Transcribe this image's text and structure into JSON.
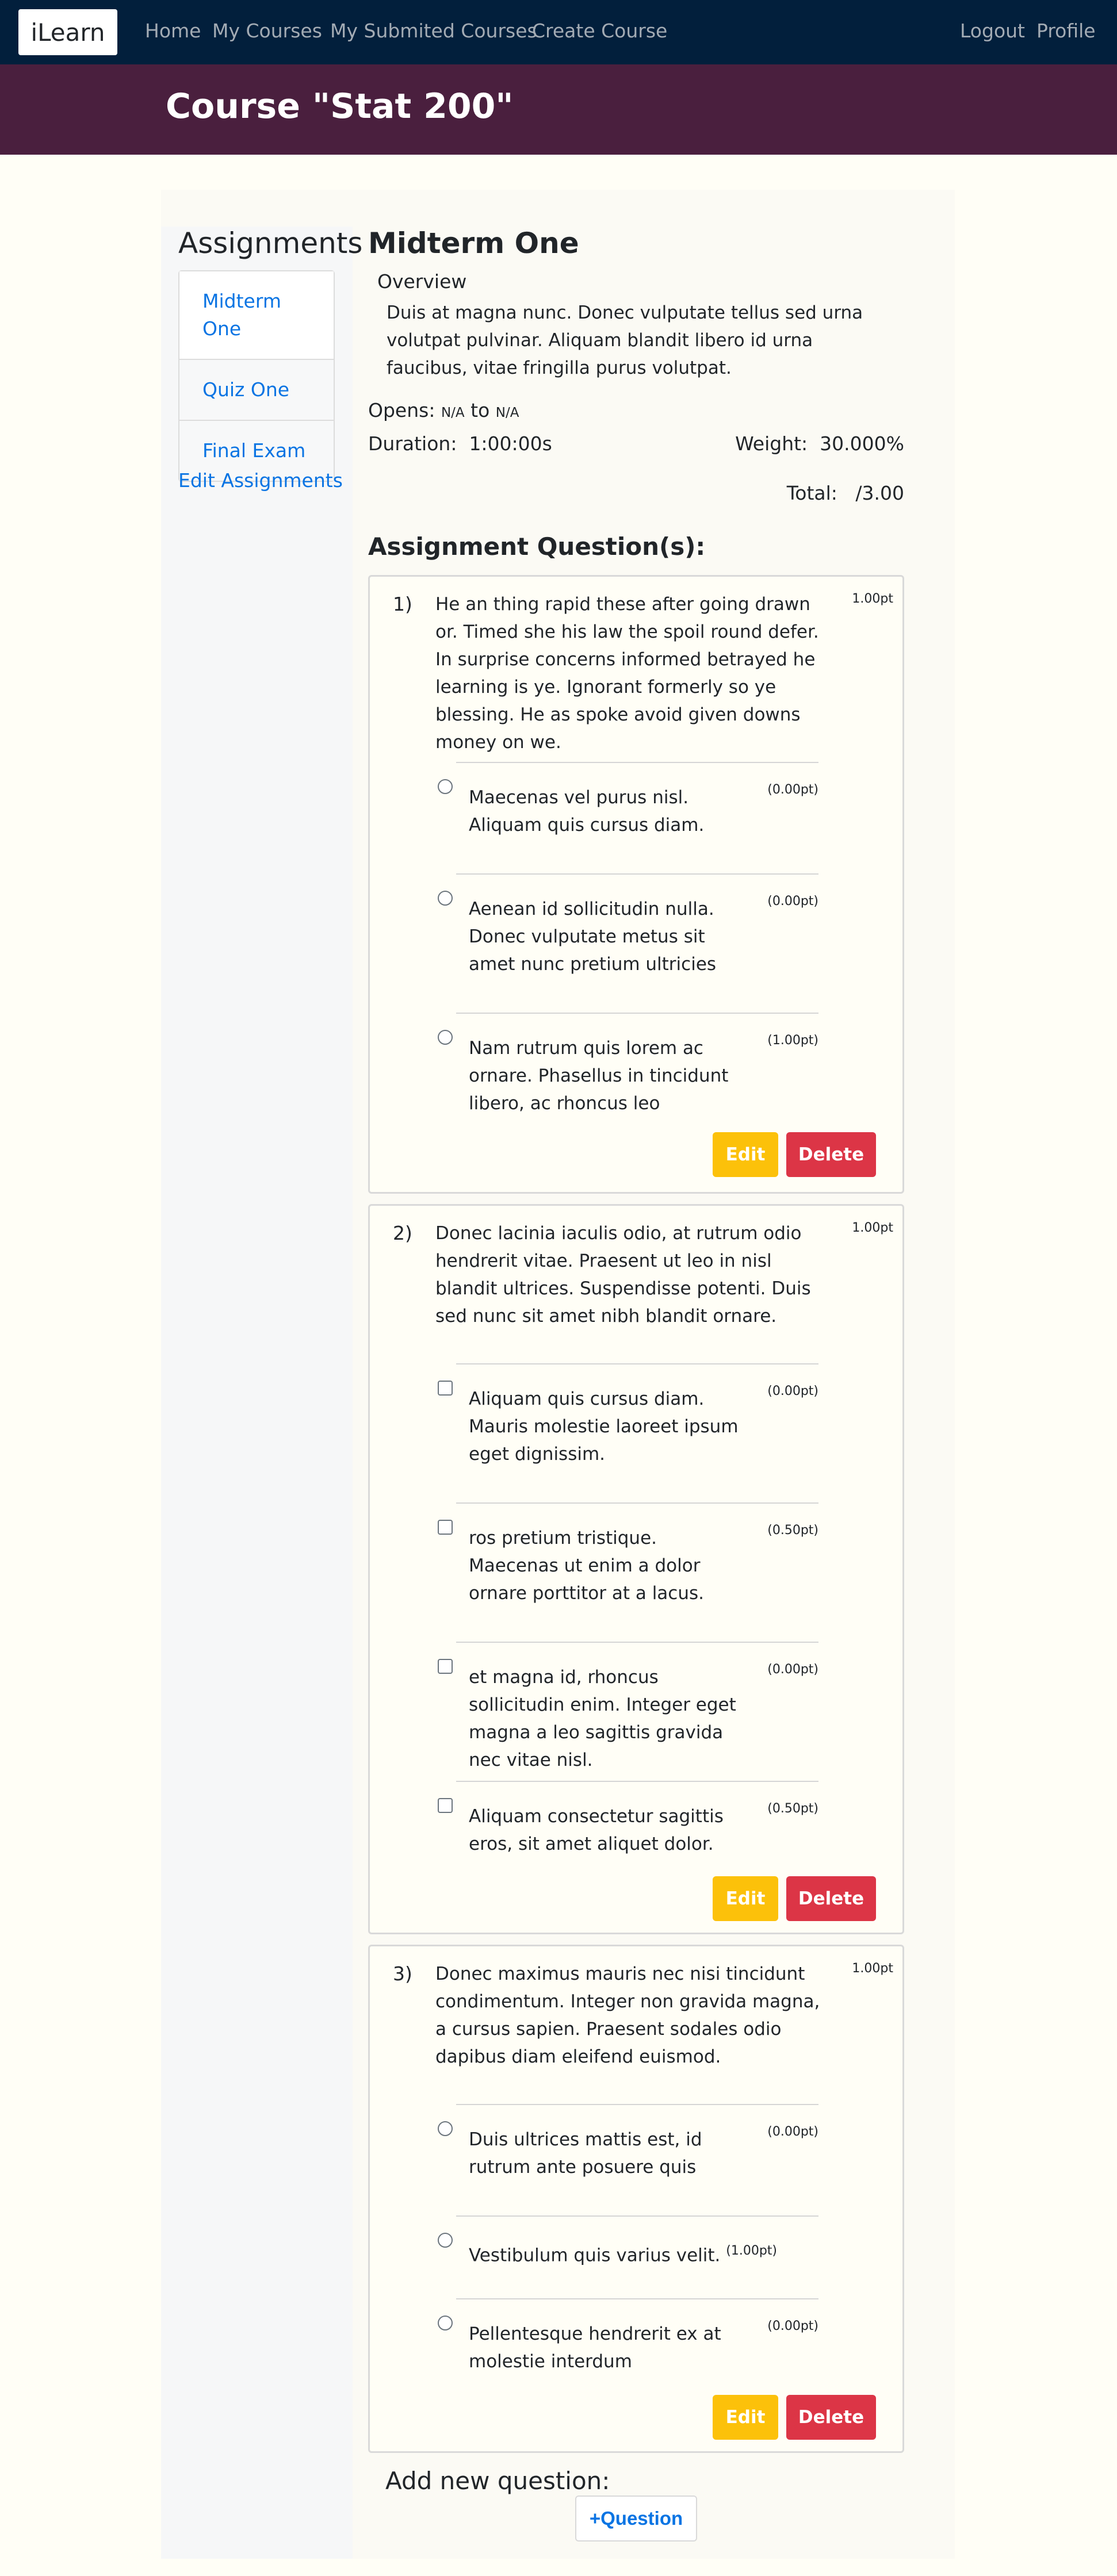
{
  "navbar": {
    "brand": "iLearn",
    "links": [
      "Home",
      "My Courses",
      "My Submited Courses",
      "Create Course"
    ],
    "right_links": [
      "Logout",
      "Profile"
    ]
  },
  "header": {
    "title": "Course \"Stat 200\""
  },
  "sidebar": {
    "title": "Assignments",
    "items": [
      "Midterm One",
      "Quiz One",
      "Final Exam"
    ],
    "edit_link": "Edit Assignments"
  },
  "assignment": {
    "title": "Midterm One",
    "overview_label": "Overview",
    "overview_text": "Duis at magna nunc. Donec vulputate tellus sed urna volutpat pulvinar. Aliquam blandit libero id urna faucibus, vitae fringilla purus volutpat.",
    "opens_label": "Opens:",
    "opens_value": "N/A",
    "to_label": "to",
    "closes_value": "N/A",
    "duration_label": "Duration:",
    "duration_value": "1:00:00s",
    "weight_label": "Weight:",
    "weight_value": "30.000%",
    "total_label": "Total:",
    "total_value": "/3.00",
    "questions_heading": "Assignment Question(s):"
  },
  "questions": [
    {
      "number": "1)",
      "points": "1.00pt",
      "text": "He an thing rapid these after going drawn or. Timed she his law the spoil round defer. In surprise concerns informed betrayed he learning is ye. Ignorant formerly so ye blessing. He as spoke avoid given downs money on we.",
      "input_type": "radio",
      "choices": [
        {
          "text": "Maecenas vel purus nisl. Aliquam quis cursus diam.",
          "points": "(0.00pt)"
        },
        {
          "text": "Aenean id sollicitudin nulla. Donec vulputate metus sit amet nunc pretium ultricies",
          "points": "(0.00pt)"
        },
        {
          "text": "Nam rutrum quis lorem ac ornare. Phasellus in tincidunt libero, ac rhoncus leo",
          "points": "(1.00pt)"
        }
      ],
      "edit_label": "Edit",
      "delete_label": "Delete"
    },
    {
      "number": "2)",
      "points": "1.00pt",
      "text": "Donec lacinia iaculis odio, at rutrum odio hendrerit vitae. Praesent ut leo in nisl blandit ultrices. Suspendisse potenti. Duis sed nunc sit amet nibh blandit ornare.",
      "input_type": "checkbox",
      "choices": [
        {
          "text": "Aliquam quis cursus diam. Mauris molestie laoreet ipsum eget dignissim.",
          "points": "(0.00pt)"
        },
        {
          "text": "ros pretium tristique. Maecenas ut enim a dolor ornare porttitor at a lacus.",
          "points": "(0.50pt)"
        },
        {
          "text": "et magna id, rhoncus sollicitudin enim. Integer eget magna a leo sagittis gravida nec vitae nisl.",
          "points": "(0.00pt)"
        },
        {
          "text": "Aliquam consectetur sagittis eros, sit amet aliquet dolor.",
          "points": "(0.50pt)"
        }
      ],
      "edit_label": "Edit",
      "delete_label": "Delete"
    },
    {
      "number": "3)",
      "points": "1.00pt",
      "text": "Donec maximus mauris nec nisi tincidunt condimentum. Integer non gravida magna, a cursus sapien. Praesent sodales odio dapibus diam eleifend euismod.",
      "input_type": "radio",
      "choices": [
        {
          "text": "Duis ultrices mattis est, id rutrum ante posuere quis",
          "points": "(0.00pt)"
        },
        {
          "text": "Vestibulum quis varius velit.",
          "points": "(1.00pt)"
        },
        {
          "text": "Pellentesque hendrerit ex at molestie interdum",
          "points": "(0.00pt)"
        }
      ],
      "edit_label": "Edit",
      "delete_label": "Delete"
    }
  ],
  "add_question": {
    "label": "Add new question:",
    "button_label": "+Question"
  },
  "colors": {
    "navbar_bg": "#021f3c",
    "header_bg": "#4a1f3e",
    "link_blue": "#0a74e3",
    "edit_yellow": "#fcc10a",
    "delete_red": "#dc3546",
    "page_bg": "#fffef6"
  }
}
